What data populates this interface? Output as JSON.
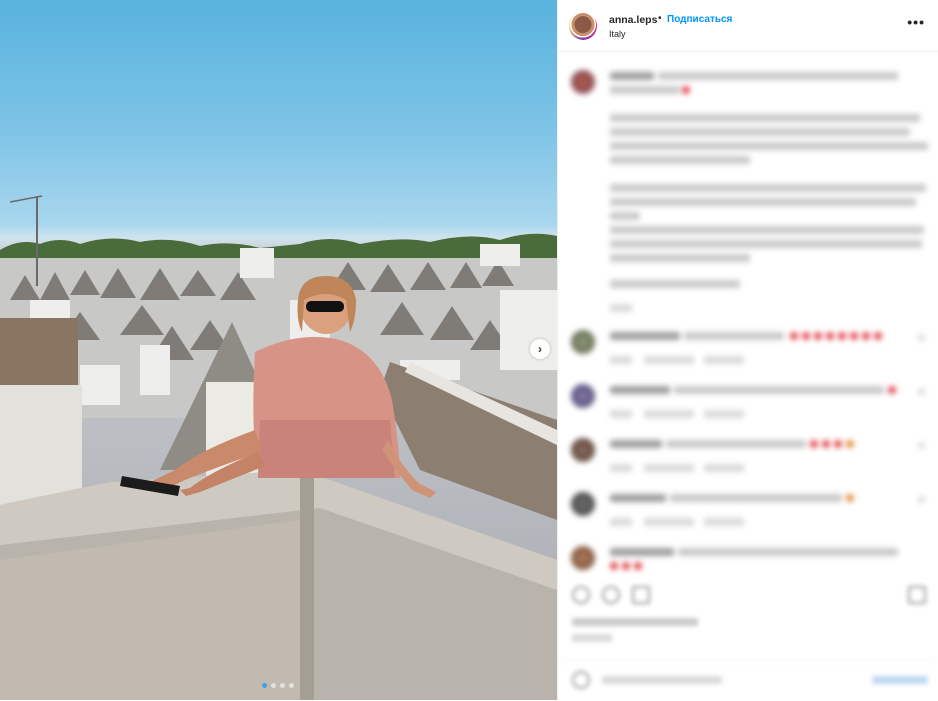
{
  "post": {
    "username": "anna.leps",
    "separator": "•",
    "follow_label": "Подписаться",
    "location": "Italy",
    "more_icon": "more-horizontal-icon"
  },
  "carousel": {
    "current_index": 1,
    "total": 4,
    "next_icon": "chevron-right-icon"
  },
  "colors": {
    "link": "#0095f6",
    "text": "#262626",
    "active_dot": "#3b9ff1"
  }
}
